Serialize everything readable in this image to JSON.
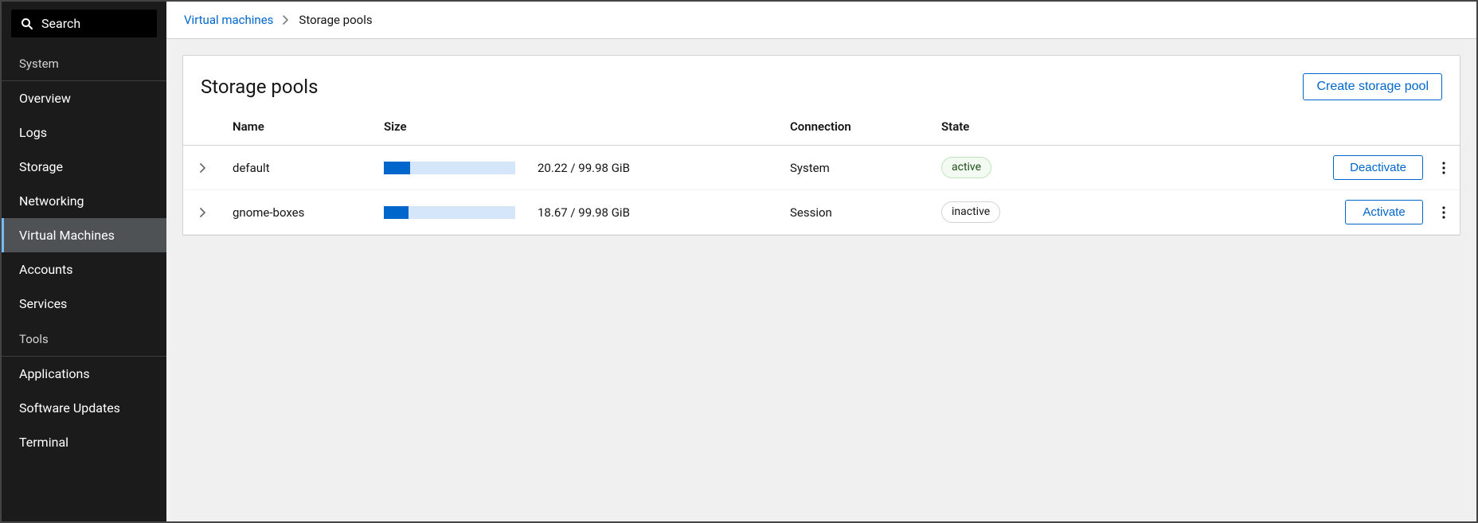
{
  "sidebar": {
    "search_label": "Search",
    "sections": [
      {
        "title": "System",
        "items": [
          {
            "label": "Overview",
            "selected": false
          },
          {
            "label": "Logs",
            "selected": false
          },
          {
            "label": "Storage",
            "selected": false
          },
          {
            "label": "Networking",
            "selected": false
          },
          {
            "label": "Virtual Machines",
            "selected": true
          },
          {
            "label": "Accounts",
            "selected": false
          },
          {
            "label": "Services",
            "selected": false
          }
        ]
      },
      {
        "title": "Tools",
        "items": [
          {
            "label": "Applications",
            "selected": false
          },
          {
            "label": "Software Updates",
            "selected": false
          },
          {
            "label": "Terminal",
            "selected": false
          }
        ]
      }
    ]
  },
  "breadcrumb": {
    "link": "Virtual machines",
    "current": "Storage pools"
  },
  "page": {
    "title": "Storage pools",
    "create_button": "Create storage pool"
  },
  "table": {
    "headers": {
      "name": "Name",
      "size": "Size",
      "connection": "Connection",
      "state": "State"
    },
    "rows": [
      {
        "name": "default",
        "used": 20.22,
        "total": 99.98,
        "unit": "GiB",
        "size_text": "20.22 / 99.98 GiB",
        "percent": 20.22,
        "connection": "System",
        "state": "active",
        "action": "Deactivate"
      },
      {
        "name": "gnome-boxes",
        "used": 18.67,
        "total": 99.98,
        "unit": "GiB",
        "size_text": "18.67 / 99.98 GiB",
        "percent": 18.67,
        "connection": "Session",
        "state": "inactive",
        "action": "Activate"
      }
    ]
  }
}
